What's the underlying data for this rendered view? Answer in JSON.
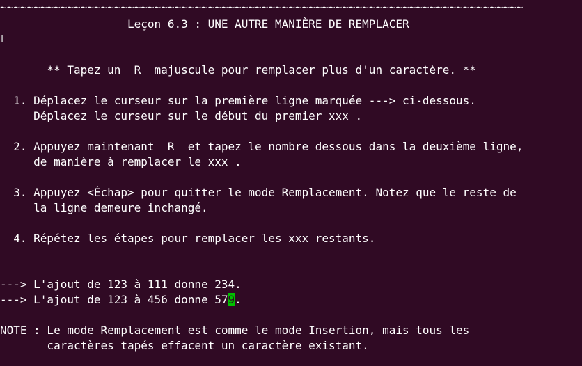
{
  "border_line": "~~~~~~~~~~~~~~~~~~~~~~~~~~~~~~~~~~~~~~~~~~~~~~~~~~~~~~~~~~~~~~~~~~~~~~~~~~~~~~",
  "title_line": "                   Leçon 6.3 : UNE AUTRE MANIÈRE DE REMPLACER",
  "intro_line": "       ** Tapez un  R  majuscule pour remplacer plus d'un caractère. **",
  "steps": {
    "s1a": "  1. Déplacez le curseur sur la première ligne marquée ---> ci-dessous.",
    "s1b": "     Déplacez le curseur sur le début du premier xxx .",
    "s2a": "  2. Appuyez maintenant  R  et tapez le nombre dessous dans la deuxième ligne,",
    "s2b": "     de manière à remplacer le xxx .",
    "s3a": "  3. Appuyez <Échap> pour quitter le mode Remplacement. Notez que le reste de",
    "s3b": "     la ligne demeure inchangé.",
    "s4": "  4. Répétez les étapes pour remplacer les xxx restants."
  },
  "example": {
    "line1": "---> L'ajout de 123 à 111 donne 234.",
    "line2_before": "---> L'ajout de 123 à 456 donne 57",
    "line2_cursor": "9",
    "line2_after": "."
  },
  "note": {
    "line1": "NOTE : Le mode Remplacement est comme le mode Insertion, mais tous les",
    "line2": "       caractères tapés effacent un caractère existant."
  },
  "colors": {
    "background": "#300a24",
    "text": "#ffffff",
    "cursor": "#00c000"
  },
  "icons": {
    "mouse_pointer": "text-ibeam-cursor"
  }
}
